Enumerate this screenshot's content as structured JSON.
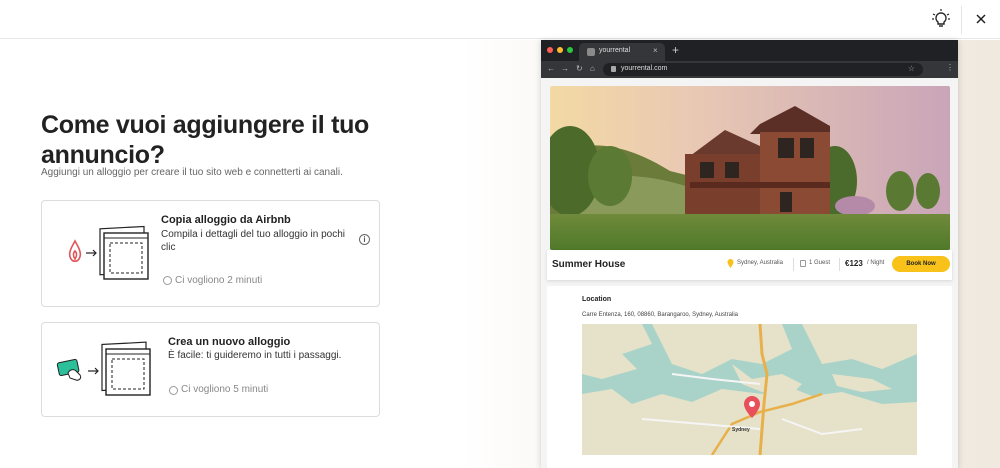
{
  "page": {
    "title": "Come vuoi aggiungere il tuo annuncio?",
    "subtitle": "Aggiungi un alloggio per creare il tuo sito web e connetterti ai canali."
  },
  "topbar": {
    "icons": [
      "lightbulb-icon",
      "close-icon"
    ]
  },
  "options": [
    {
      "title": "Copia alloggio da Airbnb",
      "description": "Compila i dettagli del tuo alloggio in pochi clic",
      "time": "Ci vogliono 2 minuti",
      "icon": "airbnb-logo-icon"
    },
    {
      "title": "Crea un nuovo alloggio",
      "description": "È facile: ti guideremo in tutti i passaggi.",
      "time": "Ci vogliono 5 minuti",
      "icon": "hand-card-icon"
    }
  ],
  "browser": {
    "tab_title": "yourrental",
    "url": "yourrental.com"
  },
  "listing": {
    "name": "Summer House",
    "location": "Sydney, Australia",
    "guests": "1 Guest",
    "price": "€123",
    "per_night": "/ Night",
    "book_label": "Book Now"
  },
  "location_section": {
    "title": "Location",
    "address": "Carre Entenza, 160, 08860, Barangaroo, Sydney, Australia",
    "map_label": "Sydney"
  },
  "colors": {
    "accent_yellow": "#f8c21a",
    "airbnb_red": "#e0565b",
    "card_green": "#2bbf9a",
    "map_pin": "#e8505b"
  }
}
